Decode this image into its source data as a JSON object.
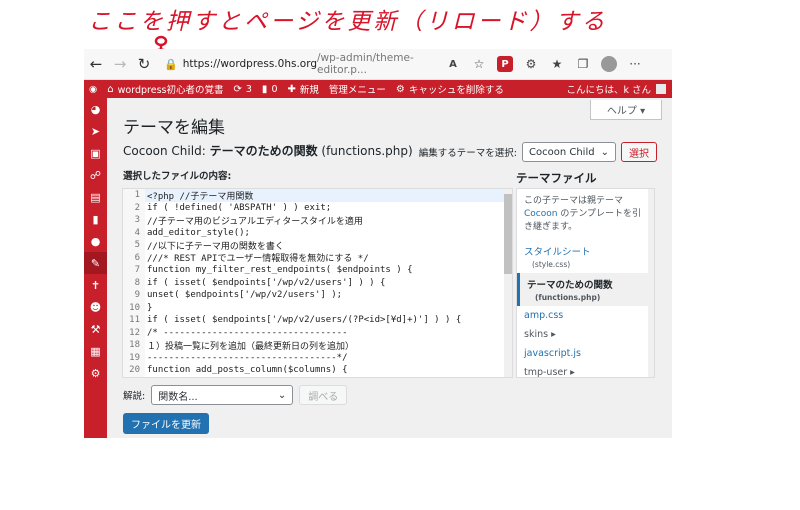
{
  "annotation": {
    "text": "ここを押すとページを更新（リロード）する",
    "color": "#d8142b"
  },
  "browser": {
    "back_icon": "back-arrow-icon",
    "forward_icon": "forward-arrow-icon",
    "refresh_icon": "refresh-icon",
    "url_host": "https://wordpress.0hs.org",
    "url_path": "/wp-admin/theme-editor.p...",
    "read_aloud_label": "A",
    "extension_badge": "P"
  },
  "adminbar": {
    "site_name": "wordpress初心者の覚書",
    "updates_count": "3",
    "comments_count": "0",
    "new_label": "新規",
    "admin_menu_label": "管理メニュー",
    "clear_cache_label": "キャッシュを削除する",
    "greeting": "こんにちは、k さん"
  },
  "main": {
    "help_label": "ヘルプ ▾",
    "page_title": "テーマを編集",
    "file_heading_prefix": "Cocoon Child: ",
    "file_heading_title": "テーマのための関数",
    "file_heading_file": " (functions.php)",
    "select_theme_label": "編集するテーマを選択:",
    "selected_theme": "Cocoon Child",
    "select_button": "選択",
    "content_label": "選択したファイルの内容:"
  },
  "code_lines": [
    {
      "n": "1",
      "t": "<?php //子テーマ用関数"
    },
    {
      "n": "2",
      "t": "if ( !defined( 'ABSPATH' ) ) exit;"
    },
    {
      "n": "3",
      "t": "//子テーマ用のビジュアルエディタースタイルを適用"
    },
    {
      "n": "4",
      "t": "add_editor_style();"
    },
    {
      "n": "5",
      "t": "//以下に子テーマ用の関数を書く"
    },
    {
      "n": "6",
      "t": "///* REST APIでユーザー情報取得を無効にする */"
    },
    {
      "n": "7",
      "t": "function my_filter_rest_endpoints( $endpoints ) {"
    },
    {
      "n": "8",
      "t": "if ( isset( $endpoints['/wp/v2/users'] ) ) {"
    },
    {
      "n": "9",
      "t": "unset( $endpoints['/wp/v2/users'] );"
    },
    {
      "n": "10",
      "t": "}"
    },
    {
      "n": "11",
      "t": "if ( isset( $endpoints['/wp/v2/users/(?P<id>[¥d]+)'] ) ) {"
    },
    {
      "n": "12",
      "t": "/* ----------------------------------"
    },
    {
      "n": "18",
      "t": "１）投稿一覧に列を追加（最終更新日の列を追加）"
    },
    {
      "n": "19",
      "t": "-----------------------------------*/"
    },
    {
      "n": "20",
      "t": "function add_posts_column($columns) {"
    }
  ],
  "theme_files": {
    "title": "テーマファイル",
    "desc_prefix": "この子テーマは親テーマ ",
    "desc_link": "Cocoon",
    "desc_suffix": " のテンプレートを引き継ぎます。",
    "items": [
      {
        "label": "スタイルシート",
        "sub": "(style.css)"
      },
      {
        "label": "テーマのための関数",
        "sub": "(functions.php)"
      },
      {
        "label": "amp.css"
      },
      {
        "label": "skins ▸"
      },
      {
        "label": "javascript.js"
      },
      {
        "label": "tmp-user ▸"
      }
    ]
  },
  "docs": {
    "label": "解説:",
    "select_placeholder": "関数名...",
    "lookup_button": "調べる"
  },
  "update_button": "ファイルを更新"
}
